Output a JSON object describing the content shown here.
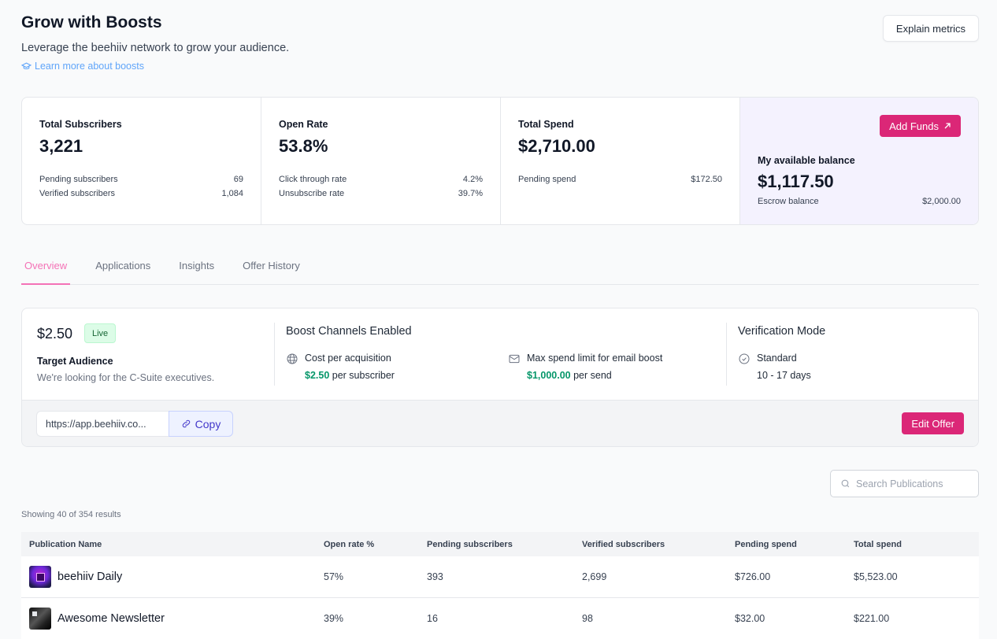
{
  "header": {
    "title": "Grow with Boosts",
    "subtitle": "Leverage the beehiiv network to grow your audience.",
    "learn_link": "Learn more about boosts",
    "explain_button": "Explain metrics"
  },
  "stats": {
    "subscribers": {
      "label": "Total Subscribers",
      "value": "3,221",
      "rows": [
        {
          "label": "Pending subscribers",
          "value": "69"
        },
        {
          "label": "Verified subscribers",
          "value": "1,084"
        }
      ]
    },
    "open_rate": {
      "label": "Open Rate",
      "value": "53.8%",
      "rows": [
        {
          "label": "Click through rate",
          "value": "4.2%"
        },
        {
          "label": "Unsubscribe rate",
          "value": "39.7%"
        }
      ]
    },
    "spend": {
      "label": "Total Spend",
      "value": "$2,710.00",
      "rows": [
        {
          "label": "Pending spend",
          "value": "$172.50"
        }
      ]
    },
    "balance": {
      "add_funds_label": "Add Funds",
      "label": "My available balance",
      "value": "$1,117.50",
      "rows": [
        {
          "label": "Escrow balance",
          "value": "$2,000.00"
        }
      ]
    }
  },
  "tabs": [
    {
      "label": "Overview",
      "active": true
    },
    {
      "label": "Applications",
      "active": false
    },
    {
      "label": "Insights",
      "active": false
    },
    {
      "label": "Offer History",
      "active": false
    }
  ],
  "offer": {
    "price": "$2.50",
    "status": "Live",
    "target_label": "Target Audience",
    "target_desc": "We're looking for the C-Suite executives.",
    "channels_title": "Boost Channels Enabled",
    "cpa_label": "Cost per acquisition",
    "cpa_value": "$2.50",
    "cpa_unit": "per subscriber",
    "email_label": "Max spend limit for email boost",
    "email_value": "$1,000.00",
    "email_unit": "per send",
    "verification_title": "Verification Mode",
    "verification_mode": "Standard",
    "verification_days": "10 - 17 days",
    "url_value": "https://app.beehiiv.co...",
    "copy_label": "Copy",
    "edit_label": "Edit Offer"
  },
  "search": {
    "placeholder": "Search Publications"
  },
  "results": {
    "summary": "Showing 40 of 354 results"
  },
  "table": {
    "columns": [
      "Publication Name",
      "Open rate %",
      "Pending subscribers",
      "Verified subscribers",
      "Pending spend",
      "Total spend"
    ],
    "rows": [
      {
        "name": "beehiiv Daily",
        "open_rate": "57%",
        "pending_subs": "393",
        "verified_subs": "2,699",
        "pending_spend": "$726.00",
        "total_spend": "$5,523.00"
      },
      {
        "name": "Awesome Newsletter",
        "open_rate": "39%",
        "pending_subs": "16",
        "verified_subs": "98",
        "pending_spend": "$32.00",
        "total_spend": "$221.00"
      }
    ]
  },
  "colors": {
    "accent": "#db2777",
    "tab_active": "#f472b6",
    "link": "#60a5fa",
    "money_green": "#059669",
    "balance_bg": "#f4f2fe"
  }
}
